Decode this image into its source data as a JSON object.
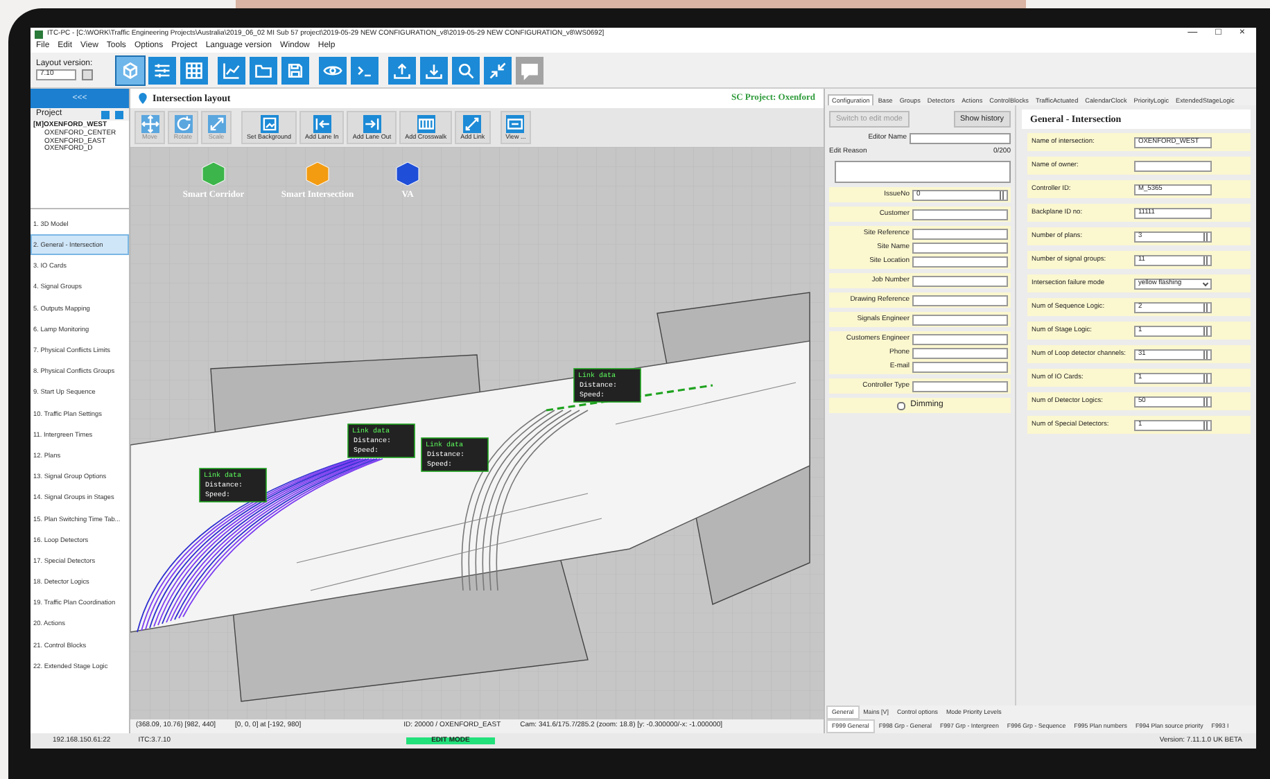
{
  "window": {
    "title": "ITC-PC - [C:\\WORK\\Traffic Engineering Projects\\Australia\\2019_06_02 MI Sub 57 project\\2019-05-29 NEW CONFIGURATION_v8\\2019-05-29 NEW CONFIGURATION_v8\\WS0692]",
    "controls": [
      "—",
      "□",
      "×"
    ]
  },
  "menu": [
    "File",
    "Edit",
    "View",
    "Tools",
    "Options",
    "Project",
    "Language version",
    "Window",
    "Help"
  ],
  "toolbar": {
    "layout_label": "Layout version:",
    "layout_value": "7.10",
    "buttons": [
      {
        "selected": true,
        "disabled": false
      },
      {
        "selected": false,
        "disabled": false
      },
      {
        "selected": false,
        "disabled": false
      },
      {
        "selected": false,
        "disabled": false
      },
      {
        "selected": false,
        "disabled": false
      },
      {
        "selected": false,
        "disabled": false
      },
      {
        "selected": false,
        "disabled": false
      },
      {
        "selected": false,
        "disabled": false
      },
      {
        "selected": false,
        "disabled": false
      },
      {
        "selected": false,
        "disabled": false
      },
      {
        "selected": false,
        "disabled": false
      },
      {
        "selected": false,
        "disabled": false
      },
      {
        "selected": false,
        "disabled": true
      }
    ]
  },
  "sidebar": {
    "collapse": "<<<",
    "project_label": "Project",
    "tree": [
      {
        "label": "[M]OXENFORD_WEST",
        "children": [
          {
            "label": "OXENFORD_CENTER"
          },
          {
            "label": "OXENFORD_EAST"
          },
          {
            "label": "OXENFORD_D"
          }
        ]
      }
    ],
    "items": [
      {
        "label": "1. 3D Model",
        "selected": false
      },
      {
        "label": "2. General - Intersection",
        "selected": true
      },
      {
        "label": "3. IO Cards",
        "selected": false
      },
      {
        "label": "4. Signal Groups",
        "selected": false
      },
      {
        "label": "5. Outputs Mapping",
        "selected": false
      },
      {
        "label": "6. Lamp Monitoring",
        "selected": false
      },
      {
        "label": "7. Physical Conflicts Limits",
        "selected": false
      },
      {
        "label": "8. Physical Conflicts Groups",
        "selected": false
      },
      {
        "label": "9. Start Up Sequence",
        "selected": false
      },
      {
        "label": "10. Traffic Plan Settings",
        "selected": false
      },
      {
        "label": "11. Intergreen Times",
        "selected": false
      },
      {
        "label": "12. Plans",
        "selected": false
      },
      {
        "label": "13. Signal Group Options",
        "selected": false
      },
      {
        "label": "14. Signal Groups in Stages",
        "selected": false
      },
      {
        "label": "15. Plan Switching Time Tab...",
        "selected": false
      },
      {
        "label": "16. Loop Detectors",
        "selected": false
      },
      {
        "label": "17. Special Detectors",
        "selected": false
      },
      {
        "label": "18. Detector Logics",
        "selected": false
      },
      {
        "label": "19. Traffic Plan Coordination",
        "selected": false
      },
      {
        "label": "20. Actions",
        "selected": false
      },
      {
        "label": "21. Control Blocks",
        "selected": false
      },
      {
        "label": "22. Extended Stage Logic",
        "selected": false
      }
    ]
  },
  "layout": {
    "title": "Intersection layout",
    "project": "SC Project: Oxenford",
    "tools": [
      {
        "label": "Move",
        "disabled": true
      },
      {
        "label": "Rotate",
        "disabled": true
      },
      {
        "label": "Scale",
        "disabled": true
      },
      {
        "label": "Set Background",
        "disabled": false
      },
      {
        "label": "Add Lane In",
        "disabled": false
      },
      {
        "label": "Add Lane Out",
        "disabled": false
      },
      {
        "label": "Add Crosswalk",
        "disabled": false
      },
      {
        "label": "Add Link",
        "disabled": false
      },
      {
        "label": "View ...",
        "disabled": false
      }
    ],
    "models": [
      {
        "label": "Smart Corridor",
        "color": "#3cb54a"
      },
      {
        "label": "Smart Intersection",
        "color": "#f39c12"
      },
      {
        "label": "VA",
        "color": "#1f4fd8"
      }
    ],
    "link_panels": [
      {
        "title": "Link data",
        "rows": [
          "Distance:",
          "Speed:"
        ]
      },
      {
        "title": "Link data",
        "rows": [
          "Distance:",
          "Speed:"
        ]
      },
      {
        "title": "Link data",
        "rows": [
          "Distance:",
          "Speed:"
        ]
      },
      {
        "title": "Link data",
        "rows": [
          "Distance:",
          "Speed:"
        ]
      }
    ],
    "status": [
      "(368.09, 10.76) [982, 440]",
      "[0, 0, 0] at [-192, 980]",
      "ID: 20000 / OXENFORD_EAST",
      "Cam: 341.6/175.7/285.2 (zoom: 18.8) [y: -0.300000/-x: -1.000000]"
    ]
  },
  "tabs": [
    {
      "label": "Configuration",
      "selected": true
    },
    {
      "label": "Base",
      "selected": false
    },
    {
      "label": "Groups",
      "selected": false
    },
    {
      "label": "Detectors",
      "selected": false
    },
    {
      "label": "Actions",
      "selected": false
    },
    {
      "label": "ControlBlocks",
      "selected": false
    },
    {
      "label": "TrafficActuated",
      "selected": false
    },
    {
      "label": "CalendarClock",
      "selected": false
    },
    {
      "label": "PriorityLogic",
      "selected": false
    },
    {
      "label": "ExtendedStageLogic",
      "selected": false
    }
  ],
  "config": {
    "edit_button": {
      "label": "Switch to edit mode",
      "disabled": true
    },
    "history_button": {
      "label": "Show history",
      "disabled": false
    },
    "editor_label": "Editor Name",
    "reason_label": "Edit Reason",
    "reason_counter": "0/200",
    "groups": [
      [
        {
          "kind": "spin",
          "label": "IssueNo",
          "value": "0"
        }
      ],
      [
        {
          "kind": "text",
          "label": "Customer"
        }
      ],
      [
        {
          "kind": "text",
          "label": "Site Reference"
        },
        {
          "kind": "text",
          "label": "Site Name"
        },
        {
          "kind": "text",
          "label": "Site Location"
        }
      ],
      [
        {
          "kind": "text",
          "label": "Job Number"
        }
      ],
      [
        {
          "kind": "text",
          "label": "Drawing Reference"
        }
      ],
      [
        {
          "kind": "text",
          "label": "Signals Engineer"
        }
      ],
      [
        {
          "kind": "text",
          "label": "Customers Engineer"
        },
        {
          "kind": "text",
          "label": "Phone"
        },
        {
          "kind": "text",
          "label": "E-mail"
        }
      ],
      [
        {
          "kind": "text",
          "label": "Controller Type"
        }
      ],
      [
        {
          "kind": "checkbox",
          "label": "Dimming",
          "checked": false
        }
      ]
    ]
  },
  "general": {
    "title": "General - Intersection",
    "fields": [
      {
        "kind": "text",
        "label": "Name of intersection:",
        "value": "OXENFORD_WEST"
      },
      {
        "kind": "text",
        "label": "Name of owner:"
      },
      {
        "kind": "text",
        "label": "Controller ID:",
        "value": "M_5365"
      },
      {
        "kind": "text",
        "label": "Backplane ID no:",
        "value": "11111"
      },
      {
        "kind": "spin",
        "label": "Number of plans:",
        "value": "3"
      },
      {
        "kind": "spin",
        "label": "Number of signal groups:",
        "value": "11"
      },
      {
        "kind": "select",
        "label": "Intersection failure mode",
        "value": "yellow flashing"
      },
      {
        "kind": "spin",
        "label": "Num of Sequence Logic:",
        "value": "2"
      },
      {
        "kind": "spin",
        "label": "Num of Stage Logic:",
        "value": "1"
      },
      {
        "kind": "spin",
        "label": "Num of Loop detector channels:",
        "value": "31"
      },
      {
        "kind": "spin",
        "label": "Num of IO Cards:",
        "value": "1"
      },
      {
        "kind": "spin",
        "label": "Num of Detector Logics:",
        "value": "50"
      },
      {
        "kind": "spin",
        "label": "Num of Special Detectors:",
        "value": "1"
      }
    ]
  },
  "sub_tabs": [
    {
      "label": "General",
      "selected": true
    },
    {
      "label": "Mains [V]",
      "selected": false
    },
    {
      "label": "Control options",
      "selected": false
    },
    {
      "label": "Mode Priority Levels",
      "selected": false
    }
  ],
  "function_tabs": [
    {
      "label": "F999 General",
      "selected": true
    },
    {
      "label": "F998 Grp - General",
      "selected": false
    },
    {
      "label": "F997 Grp - Intergreen",
      "selected": false
    },
    {
      "label": "F996 Grp - Sequence",
      "selected": false
    },
    {
      "label": "F995 Plan numbers",
      "selected": false
    },
    {
      "label": "F994 Plan source priority",
      "selected": false
    },
    {
      "label": "F993 I",
      "selected": false
    }
  ],
  "status_bar": {
    "address": "192.168.150.61:22",
    "itc": "ITC:3.7.10",
    "mode": "EDIT MODE",
    "version": "Version: 7.11.1.0 UK BETA"
  }
}
